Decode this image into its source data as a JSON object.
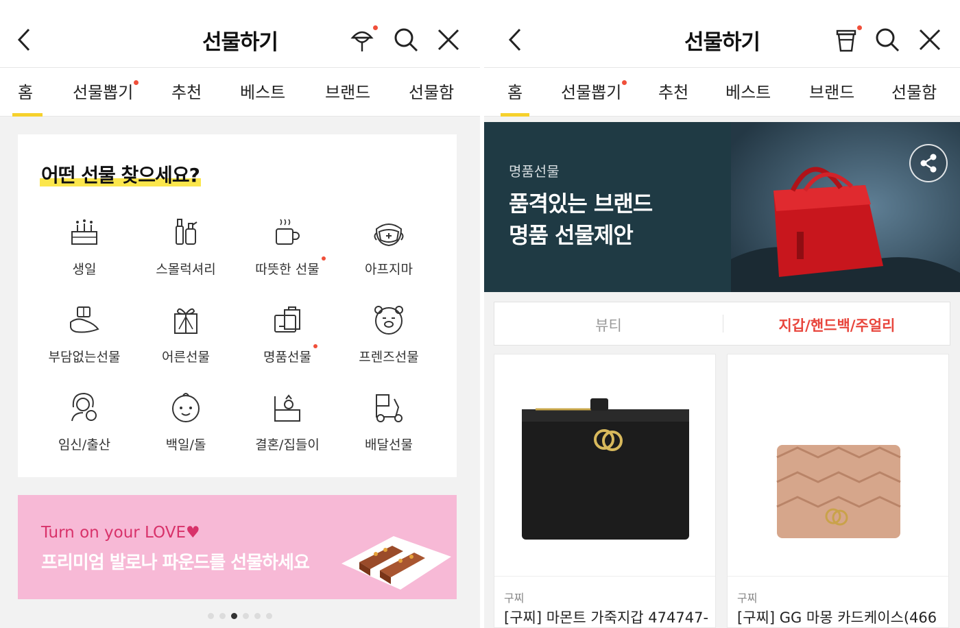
{
  "left": {
    "header": {
      "title": "선물하기"
    },
    "tabs": [
      "홈",
      "선물뽑기",
      "추천",
      "베스트",
      "브랜드",
      "선물함"
    ],
    "card": {
      "title": "어떤 선물 찾으세요?",
      "categories": [
        {
          "label": "생일",
          "icon": "birthday-cake-icon"
        },
        {
          "label": "스몰럭셔리",
          "icon": "cosmetics-icon"
        },
        {
          "label": "따뜻한 선물",
          "icon": "hot-cup-icon",
          "new": true
        },
        {
          "label": "아프지마",
          "icon": "mask-face-icon"
        },
        {
          "label": "부담없는선물",
          "icon": "gift-hand-icon"
        },
        {
          "label": "어른선물",
          "icon": "gift-box-icon"
        },
        {
          "label": "명품선물",
          "icon": "shopping-bag-icon",
          "new": true
        },
        {
          "label": "프렌즈선물",
          "icon": "bear-face-icon"
        },
        {
          "label": "임신/출산",
          "icon": "mother-baby-icon"
        },
        {
          "label": "백일/돌",
          "icon": "baby-face-icon"
        },
        {
          "label": "결혼/집들이",
          "icon": "ring-box-icon"
        },
        {
          "label": "배달선물",
          "icon": "delivery-scooter-icon"
        }
      ]
    },
    "promo": {
      "line1": "Turn on your LOVE♥",
      "line2": "프리미엄 발로나 파운드를 선물하세요"
    }
  },
  "right": {
    "header": {
      "title": "선물하기"
    },
    "tabs": [
      "홈",
      "선물뽑기",
      "추천",
      "베스트",
      "브랜드",
      "선물함"
    ],
    "hero": {
      "small": "명품선물",
      "line1": "품격있는 브랜드",
      "line2": "명품 선물제안"
    },
    "segments": [
      "뷰티",
      "지갑/핸드백/주얼리"
    ],
    "products": [
      {
        "brand": "구찌",
        "name": "[구찌] 마몬트 가죽지갑 474747-"
      },
      {
        "brand": "구찌",
        "name": "[구찌] GG 마몽 카드케이스(466"
      }
    ]
  },
  "colors": {
    "accent_yellow": "#f6d12c",
    "alert_red": "#f04f3a",
    "segment_active": "#e8453c",
    "promo_pink": "#f7b9d6",
    "hero_bg": "#1f3a44"
  }
}
